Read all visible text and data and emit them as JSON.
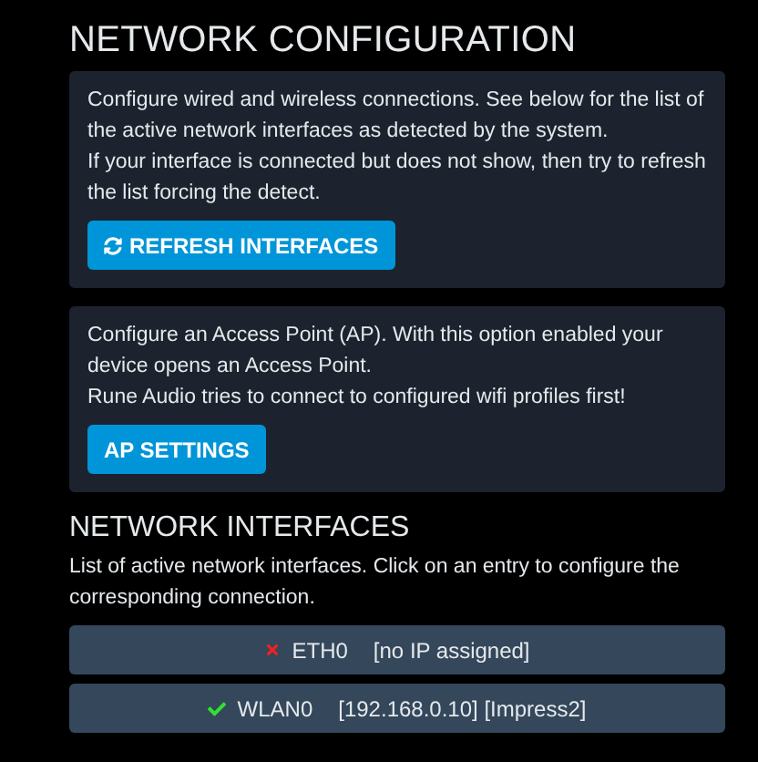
{
  "title": "NETWORK CONFIGURATION",
  "panels": [
    {
      "lines": [
        "Configure wired and wireless connections. See below for the list of the active network interfaces as detected by the system.",
        "If your interface is connected but does not show, then try to refresh the list forcing the detect."
      ],
      "button": {
        "label": "REFRESH INTERFACES",
        "kind": "refresh"
      }
    },
    {
      "lines": [
        "Configure an Access Point (AP). With this option enabled your device opens an Access Point.",
        "Rune Audio tries to connect to configured wifi profiles first!"
      ],
      "button": {
        "label": "AP SETTINGS",
        "kind": "plain"
      }
    }
  ],
  "interfaces_section": {
    "title": "NETWORK INTERFACES",
    "description": "List of active network interfaces. Click on an entry to configure the corresponding connection.",
    "interfaces": [
      {
        "name": "ETH0",
        "details": "[no IP assigned]",
        "connected": false
      },
      {
        "name": "WLAN0",
        "details": "[192.168.0.10] [Impress2]",
        "connected": true
      }
    ]
  }
}
